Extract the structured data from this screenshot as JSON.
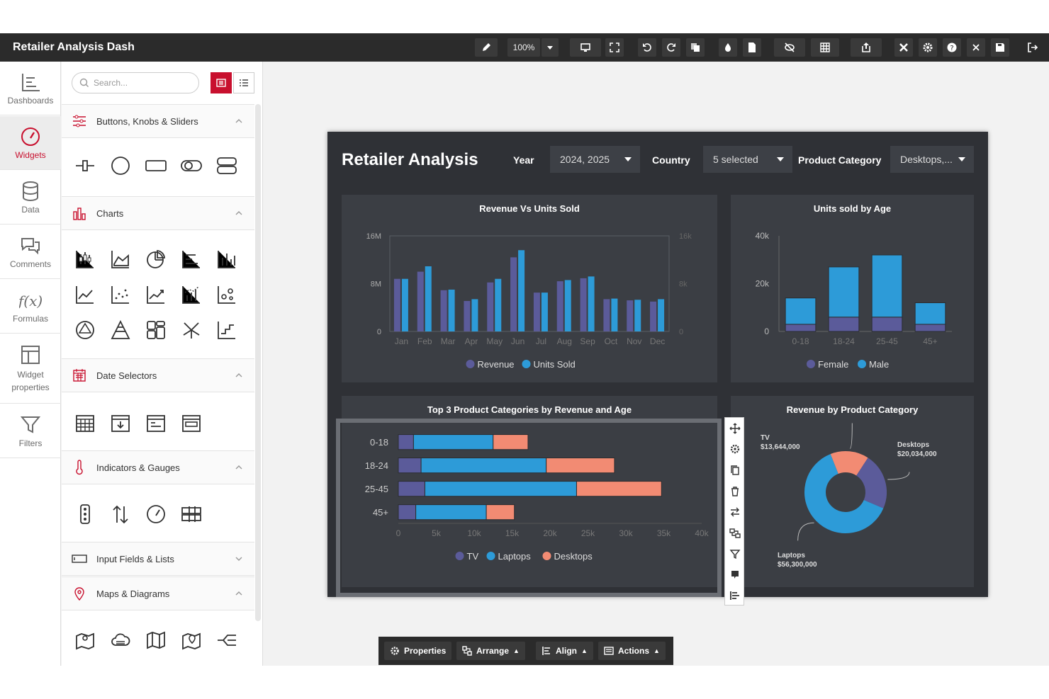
{
  "app": {
    "title": "Retailer Analysis Dash"
  },
  "toolbar": {
    "zoom": "100%"
  },
  "nav": [
    {
      "label": "Dashboards"
    },
    {
      "label": "Widgets"
    },
    {
      "label": "Data"
    },
    {
      "label": "Comments"
    },
    {
      "label": "Formulas"
    },
    {
      "label": "Widget properties"
    },
    {
      "label": "Filters"
    }
  ],
  "widgets_panel": {
    "search_placeholder": "Search...",
    "sections": [
      "Buttons, Knobs & Sliders",
      "Charts",
      "Date Selectors",
      "Indicators & Gauges",
      "Input Fields & Lists",
      "Maps & Diagrams"
    ]
  },
  "dashboard": {
    "title": "Retailer Analysis",
    "filters": {
      "year_label": "Year",
      "year_value": "2024, 2025",
      "country_label": "Country",
      "country_value": "5 selected",
      "category_label": "Product Category",
      "category_value": "Desktops,..."
    }
  },
  "colors": {
    "purple": "#5b5b9a",
    "blue": "#2d9bd8",
    "salmon": "#f28b73",
    "canvas": "#2f3136",
    "panel": "#3b3e44",
    "accent": "#c8102e"
  },
  "chart_data": [
    {
      "type": "bar",
      "title": "Revenue Vs Units Sold",
      "categories": [
        "Jan",
        "Feb",
        "Mar",
        "Apr",
        "May",
        "Jun",
        "Jul",
        "Aug",
        "Sep",
        "Oct",
        "Nov",
        "Dec"
      ],
      "series": [
        {
          "name": "Revenue",
          "axis": "left",
          "values": [
            8.8,
            10.0,
            6.9,
            5.1,
            8.2,
            12.4,
            6.5,
            8.4,
            8.9,
            5.4,
            5.2,
            5.0
          ]
        },
        {
          "name": "Units Sold",
          "axis": "right",
          "values": [
            8.8,
            10.9,
            7.0,
            5.4,
            8.8,
            13.6,
            6.5,
            8.6,
            9.2,
            5.5,
            5.3,
            5.4
          ]
        }
      ],
      "yticks_left": [
        "0",
        "8M",
        "16M"
      ],
      "yticks_right": [
        "0",
        "8k",
        "16k"
      ],
      "ylim": [
        0,
        16
      ],
      "legend": "bottom"
    },
    {
      "type": "bar",
      "stacked": true,
      "title": "Units sold by Age",
      "categories": [
        "0-18",
        "18-24",
        "25-45",
        "45+"
      ],
      "series": [
        {
          "name": "Female",
          "values": [
            3,
            6,
            6,
            3
          ]
        },
        {
          "name": "Male",
          "values": [
            11,
            21,
            26,
            9
          ]
        }
      ],
      "yticks": [
        "0",
        "20k",
        "40k"
      ],
      "ylim": [
        0,
        40
      ],
      "legend": "bottom"
    },
    {
      "type": "bar",
      "orientation": "horizontal",
      "stacked": true,
      "title": "Top 3 Product Categories by Revenue and Age",
      "categories": [
        "0-18",
        "18-24",
        "25-45",
        "45+"
      ],
      "series": [
        {
          "name": "TV",
          "values": [
            2,
            3,
            3.5,
            2.3
          ]
        },
        {
          "name": "Laptops",
          "values": [
            10.5,
            16.5,
            20,
            9.3
          ]
        },
        {
          "name": "Desktops",
          "values": [
            4.6,
            9,
            11.2,
            3.7
          ]
        }
      ],
      "xticks": [
        "0",
        "5k",
        "10k",
        "15k",
        "20k",
        "25k",
        "30k",
        "35k",
        "40k"
      ],
      "xlim": [
        0,
        40
      ],
      "legend": "bottom"
    },
    {
      "type": "pie",
      "donut": true,
      "title": "Revenue by Product Category",
      "slices": [
        {
          "name": "TV",
          "value": 13644000,
          "label": "TV",
          "amount": "$13,644,000"
        },
        {
          "name": "Desktops",
          "value": 20034000,
          "label": "Desktops",
          "amount": "$20,034,000"
        },
        {
          "name": "Laptops",
          "value": 56300000,
          "label": "Laptops",
          "amount": "$56,300,000"
        }
      ]
    }
  ],
  "bottombar": {
    "properties": "Properties",
    "arrange": "Arrange",
    "align": "Align",
    "actions": "Actions"
  }
}
